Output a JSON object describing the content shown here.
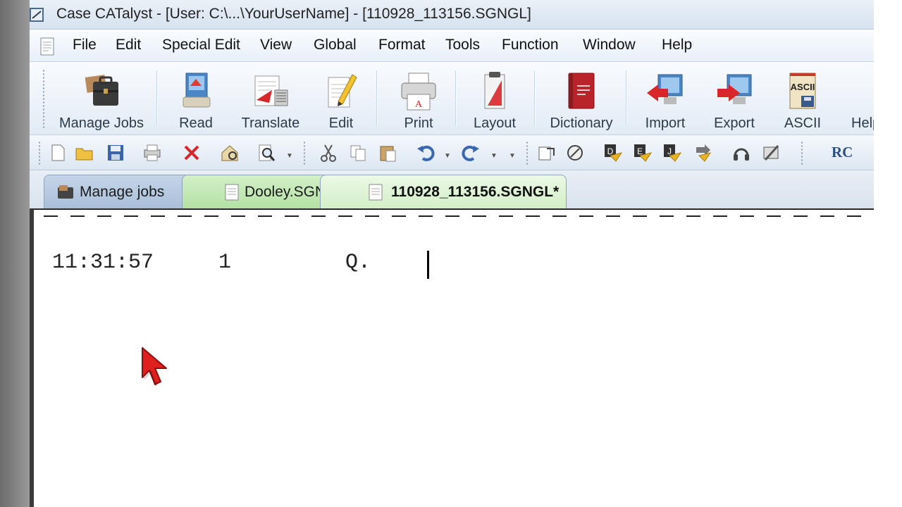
{
  "window": {
    "title": "Case CATalyst - [User: C:\\...\\YourUserName] - [110928_113156.SGNGL]",
    "app_icon": "catalyst-app-icon"
  },
  "menu": {
    "items": [
      "File",
      "Edit",
      "Special Edit",
      "View",
      "Global",
      "Format",
      "Tools",
      "Function",
      "Window",
      "Help"
    ]
  },
  "toolbar": {
    "buttons": [
      {
        "label": "Manage Jobs",
        "icon": "briefcase-icon"
      },
      {
        "label": "Read",
        "icon": "read-icon"
      },
      {
        "label": "Translate",
        "icon": "translate-icon"
      },
      {
        "label": "Edit",
        "icon": "pencil-icon"
      },
      {
        "label": "Print",
        "icon": "printer-icon"
      },
      {
        "label": "Layout",
        "icon": "layout-icon"
      },
      {
        "label": "Dictionary",
        "icon": "dictionary-icon"
      },
      {
        "label": "Import",
        "icon": "import-icon"
      },
      {
        "label": "Export",
        "icon": "export-icon"
      },
      {
        "label": "ASCII",
        "icon": "ascii-icon"
      },
      {
        "label": "Help",
        "icon": "help-icon"
      }
    ],
    "ascii_badge": "ASCII"
  },
  "small_toolbar": {
    "rc_label": "RC"
  },
  "tabs": [
    {
      "label": "Manage jobs",
      "icon": "manage-jobs-icon"
    },
    {
      "label": "Dooley.SGNGL",
      "icon": "document-icon"
    },
    {
      "label": "110928_113156.SGNGL*",
      "icon": "document-icon",
      "active": true
    }
  ],
  "editor": {
    "timestamp": "11:31:57",
    "line_number": "1",
    "text": "Q."
  },
  "colors": {
    "title_bg": "#d6e2ef",
    "active_tab": "#d3efc8",
    "jobs_tab": "#a9bfd9",
    "accent_red": "#d8262a"
  }
}
